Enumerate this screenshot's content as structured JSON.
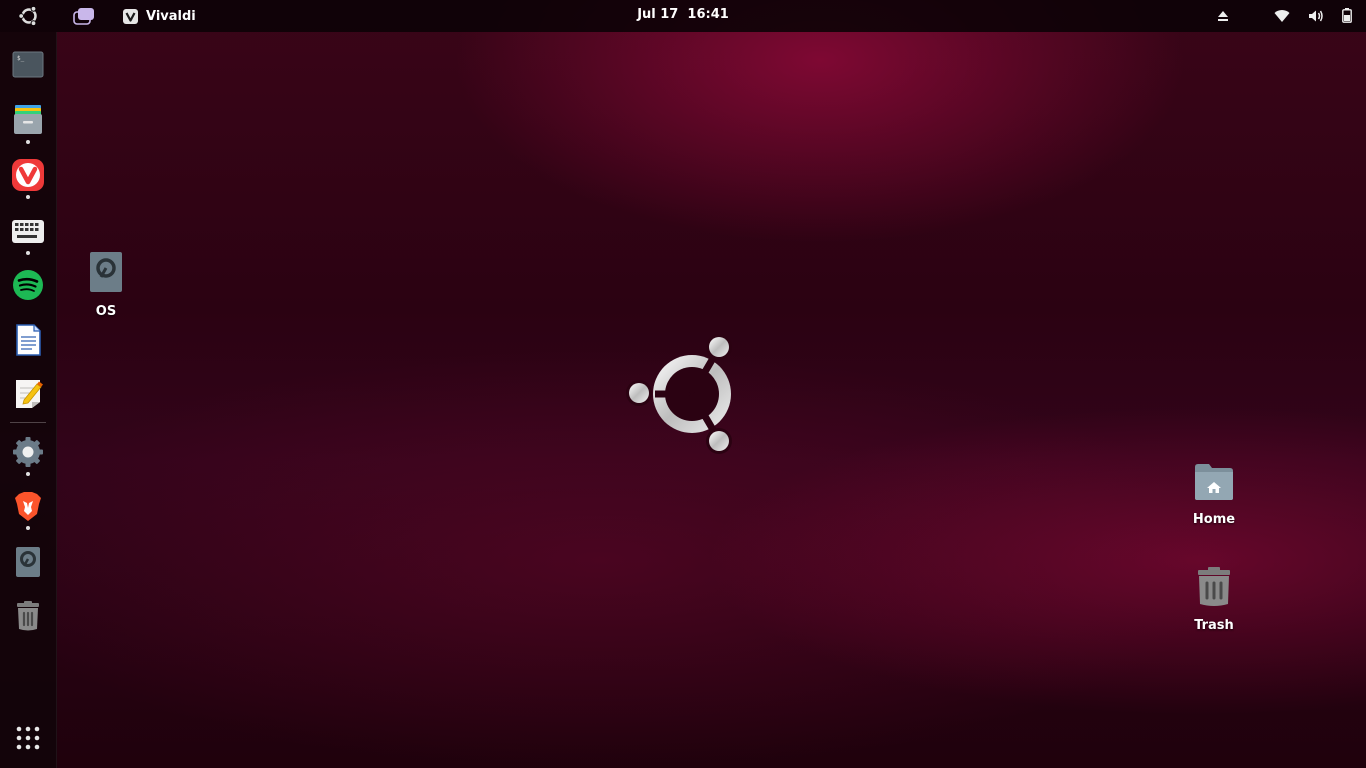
{
  "topbar": {
    "app_name": "Vivaldi",
    "clock": "Jul 17  16:41",
    "icons": [
      "ubuntu-activities-icon",
      "workspace-indicator-icon",
      "eject-icon",
      "wifi-icon",
      "volume-icon",
      "battery-icon"
    ]
  },
  "dock": {
    "items": [
      {
        "name": "terminal",
        "running": false
      },
      {
        "name": "files",
        "running": true
      },
      {
        "name": "vivaldi",
        "running": true
      },
      {
        "name": "onboard-keyboard",
        "running": true
      },
      {
        "name": "spotify",
        "running": false
      },
      {
        "name": "libreoffice-writer",
        "running": false
      },
      {
        "name": "text-editor",
        "running": false
      },
      {
        "name": "settings",
        "running": true
      },
      {
        "name": "brave",
        "running": true
      },
      {
        "name": "disk-drive",
        "running": false
      },
      {
        "name": "trash",
        "running": false
      }
    ],
    "show_apps": "show-applications-icon"
  },
  "desktop": {
    "os_label": "OS",
    "home_label": "Home",
    "trash_label": "Trash"
  },
  "colors": {
    "topbar_bg": "#0a0206",
    "wallpaper_dark": "#2b0212",
    "wallpaper_accent": "#96103c",
    "vivaldi_red": "#ef3939",
    "spotify_green": "#1db954",
    "brave_orange": "#fb542b"
  }
}
